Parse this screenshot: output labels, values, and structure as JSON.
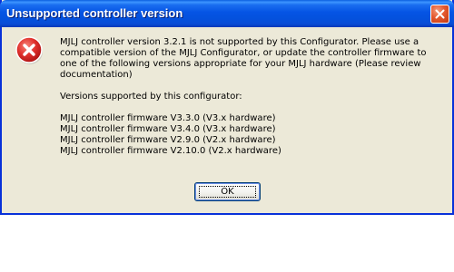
{
  "dialog": {
    "title": "Unsupported controller version",
    "icon": "error-icon",
    "message": {
      "intro": "MJLJ controller version 3.2.1  is not supported by this Configurator. Please use a compatible version of the MJLJ Configurator, or update the controller firmware to one of the following versions appropriate for your MJLJ hardware (Please review documentation)",
      "supported_heading": "Versions supported by this configurator:",
      "versions": [
        "MJLJ controller firmware V3.3.0 (V3.x hardware)",
        "MJLJ controller firmware V3.4.0 (V3.x hardware)",
        "MJLJ controller firmware V2.9.0 (V2.x hardware)",
        "MJLJ controller firmware V2.10.0 (V2.x hardware)"
      ]
    },
    "ok_label": "OK",
    "close_icon": "close-icon"
  },
  "colors": {
    "titlebar": "#0554e4",
    "dialog_background": "#ece9d8",
    "error_red": "#d8262c",
    "close_button": "#e4582f"
  }
}
